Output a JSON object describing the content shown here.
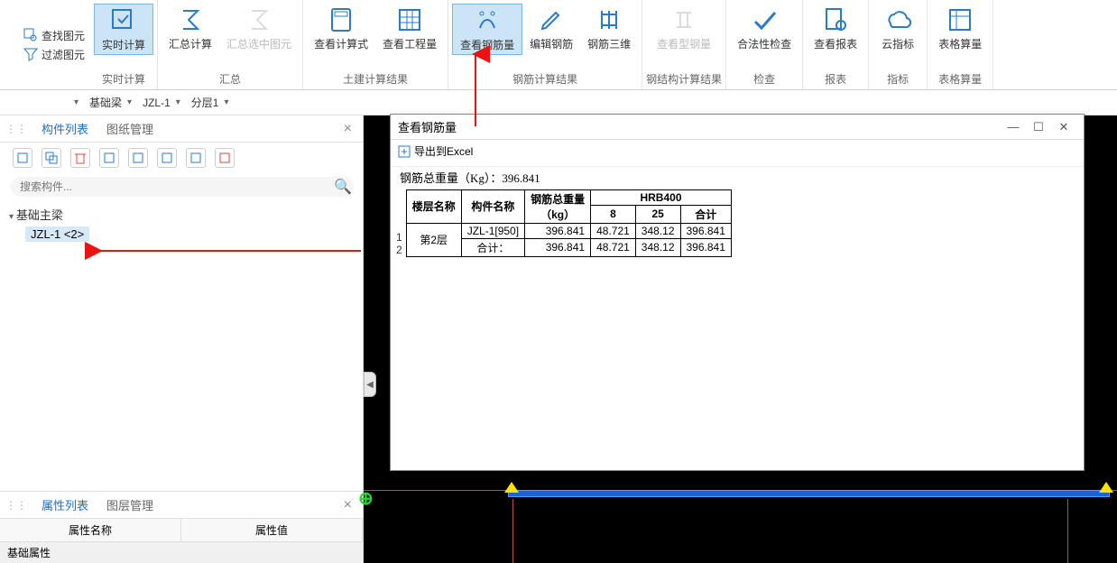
{
  "ribbon": {
    "small": {
      "find": "查找图元",
      "filter": "过滤图元"
    },
    "groups": [
      {
        "label": "实时计算",
        "buttons": [
          {
            "key": "realtime",
            "label": "实时计算",
            "active": true
          }
        ]
      },
      {
        "label": "汇总",
        "buttons": [
          {
            "key": "sumcalc",
            "label": "汇总计算"
          },
          {
            "key": "sumsel",
            "label": "汇总选中图元",
            "disabled": true
          }
        ]
      },
      {
        "label": "土建计算结果",
        "buttons": [
          {
            "key": "viewcalc",
            "label": "查看计算式"
          },
          {
            "key": "vieweng",
            "label": "查看工程量"
          }
        ]
      },
      {
        "label": "钢筋计算结果",
        "buttons": [
          {
            "key": "viewrebar",
            "label": "查看钢筋量",
            "active": true
          },
          {
            "key": "editrebar",
            "label": "编辑钢筋"
          },
          {
            "key": "rebar3d",
            "label": "钢筋三维"
          }
        ]
      },
      {
        "label": "钢结构计算结果",
        "buttons": [
          {
            "key": "viewsteel",
            "label": "查看型钢量",
            "disabled": true
          }
        ]
      },
      {
        "label": "检查",
        "buttons": [
          {
            "key": "legalchk",
            "label": "合法性检查"
          }
        ]
      },
      {
        "label": "报表",
        "buttons": [
          {
            "key": "viewrpt",
            "label": "查看报表"
          }
        ]
      },
      {
        "label": "指标",
        "buttons": [
          {
            "key": "cloudidx",
            "label": "云指标"
          }
        ]
      },
      {
        "label": "表格算量",
        "buttons": [
          {
            "key": "tablecalc",
            "label": "表格算量"
          }
        ]
      }
    ]
  },
  "selectors": {
    "a": "基础梁",
    "b": "JZL-1",
    "c": "分层1"
  },
  "left": {
    "tabs": {
      "a": "构件列表",
      "b": "图纸管理"
    },
    "search_ph": "搜索构件...",
    "tree_parent": "基础主梁",
    "tree_child": "JZL-1 <2>",
    "prop_tabs": {
      "a": "属性列表",
      "b": "图层管理"
    },
    "prop_cols": {
      "a": "属性名称",
      "b": "属性值"
    },
    "prop_cat": "基础属性"
  },
  "dialog": {
    "title": "查看钢筋量",
    "export": "导出到Excel",
    "summary": "钢筋总重量（Kg）：396.841",
    "headers": {
      "floor": "楼层名称",
      "comp": "构件名称",
      "total": "钢筋总重量\n（kg）",
      "grade": "HRB400",
      "c8": "8",
      "c25": "25",
      "csum": "合计"
    },
    "rows": [
      {
        "n": "1",
        "floor": "第2层",
        "comp": "JZL-1[950]",
        "total": "396.841",
        "c8": "48.721",
        "c25": "348.12",
        "csum": "396.841"
      },
      {
        "n": "2",
        "floor": "",
        "comp": "合计：",
        "total": "396.841",
        "c8": "48.721",
        "c25": "348.12",
        "csum": "396.841"
      }
    ]
  }
}
